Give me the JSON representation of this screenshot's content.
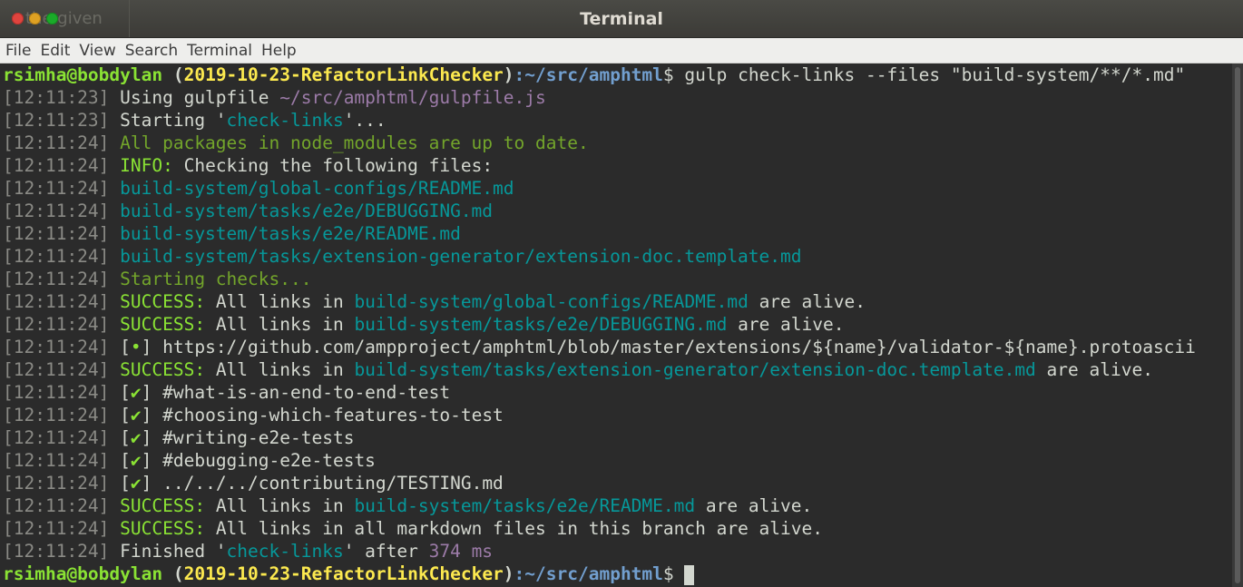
{
  "window": {
    "title": "Terminal",
    "ghost_tab": "the given"
  },
  "menu": [
    "File",
    "Edit",
    "View",
    "Search",
    "Terminal",
    "Help"
  ],
  "prompt": {
    "user_host": "rsimha@bobdylan",
    "branch_open": " (",
    "branch": "2019-10-23-RefactorLinkChecker",
    "branch_close": ")",
    "path": ":~/src/amphtml",
    "dollar": "$ ",
    "command": "gulp check-links --files \"build-system/**/*.md\""
  },
  "lines": [
    [
      {
        "t": "[12:11:23] ",
        "c": "gray"
      },
      {
        "t": "Using gulpfile ",
        "c": "white"
      },
      {
        "t": "~/src/amphtml/gulpfile.js",
        "c": "magenta"
      }
    ],
    [
      {
        "t": "[12:11:23] ",
        "c": "gray"
      },
      {
        "t": "Starting '",
        "c": "white"
      },
      {
        "t": "check-links",
        "c": "cyan"
      },
      {
        "t": "'...",
        "c": "white"
      }
    ],
    [
      {
        "t": "[12:11:24] ",
        "c": "gray"
      },
      {
        "t": "All packages in node_modules are up to date.",
        "c": "green"
      }
    ],
    [
      {
        "t": "[12:11:24] ",
        "c": "gray"
      },
      {
        "t": "INFO: ",
        "c": "yg"
      },
      {
        "t": "Checking the following files:",
        "c": "white"
      }
    ],
    [
      {
        "t": "[12:11:24] ",
        "c": "gray"
      },
      {
        "t": "build-system/global-configs/README.md",
        "c": "cyan"
      }
    ],
    [
      {
        "t": "[12:11:24] ",
        "c": "gray"
      },
      {
        "t": "build-system/tasks/e2e/DEBUGGING.md",
        "c": "cyan"
      }
    ],
    [
      {
        "t": "[12:11:24] ",
        "c": "gray"
      },
      {
        "t": "build-system/tasks/e2e/README.md",
        "c": "cyan"
      }
    ],
    [
      {
        "t": "[12:11:24] ",
        "c": "gray"
      },
      {
        "t": "build-system/tasks/extension-generator/extension-doc.template.md",
        "c": "cyan"
      }
    ],
    [
      {
        "t": "[12:11:24] ",
        "c": "gray"
      },
      {
        "t": "Starting checks...",
        "c": "green"
      }
    ],
    [
      {
        "t": "[12:11:24] ",
        "c": "gray"
      },
      {
        "t": "SUCCESS: ",
        "c": "yg"
      },
      {
        "t": "All links in ",
        "c": "white"
      },
      {
        "t": "build-system/global-configs/README.md",
        "c": "cyan"
      },
      {
        "t": " are alive.",
        "c": "white"
      }
    ],
    [
      {
        "t": "[12:11:24] ",
        "c": "gray"
      },
      {
        "t": "SUCCESS: ",
        "c": "yg"
      },
      {
        "t": "All links in ",
        "c": "white"
      },
      {
        "t": "build-system/tasks/e2e/DEBUGGING.md",
        "c": "cyan"
      },
      {
        "t": " are alive.",
        "c": "white"
      }
    ],
    [
      {
        "t": "[12:11:24] ",
        "c": "gray"
      },
      {
        "t": "[",
        "c": "white"
      },
      {
        "t": "•",
        "c": "yg"
      },
      {
        "t": "] https://github.com/ampproject/amphtml/blob/master/extensions/${name}/validator-${name}.protoascii",
        "c": "white"
      }
    ],
    [
      {
        "t": "[12:11:24] ",
        "c": "gray"
      },
      {
        "t": "SUCCESS: ",
        "c": "yg"
      },
      {
        "t": "All links in ",
        "c": "white"
      },
      {
        "t": "build-system/tasks/extension-generator/extension-doc.template.md",
        "c": "cyan"
      },
      {
        "t": " are alive.",
        "c": "white"
      }
    ],
    [
      {
        "t": "[12:11:24] ",
        "c": "gray"
      },
      {
        "t": "[",
        "c": "white"
      },
      {
        "t": "✔",
        "c": "yg"
      },
      {
        "t": "] #what-is-an-end-to-end-test",
        "c": "white"
      }
    ],
    [
      {
        "t": "[12:11:24] ",
        "c": "gray"
      },
      {
        "t": "[",
        "c": "white"
      },
      {
        "t": "✔",
        "c": "yg"
      },
      {
        "t": "] #choosing-which-features-to-test",
        "c": "white"
      }
    ],
    [
      {
        "t": "[12:11:24] ",
        "c": "gray"
      },
      {
        "t": "[",
        "c": "white"
      },
      {
        "t": "✔",
        "c": "yg"
      },
      {
        "t": "] #writing-e2e-tests",
        "c": "white"
      }
    ],
    [
      {
        "t": "[12:11:24] ",
        "c": "gray"
      },
      {
        "t": "[",
        "c": "white"
      },
      {
        "t": "✔",
        "c": "yg"
      },
      {
        "t": "] #debugging-e2e-tests",
        "c": "white"
      }
    ],
    [
      {
        "t": "[12:11:24] ",
        "c": "gray"
      },
      {
        "t": "[",
        "c": "white"
      },
      {
        "t": "✔",
        "c": "yg"
      },
      {
        "t": "] ../../../contributing/TESTING.md",
        "c": "white"
      }
    ],
    [
      {
        "t": "[12:11:24] ",
        "c": "gray"
      },
      {
        "t": "SUCCESS: ",
        "c": "yg"
      },
      {
        "t": "All links in ",
        "c": "white"
      },
      {
        "t": "build-system/tasks/e2e/README.md",
        "c": "cyan"
      },
      {
        "t": " are alive.",
        "c": "white"
      }
    ],
    [
      {
        "t": "[12:11:24] ",
        "c": "gray"
      },
      {
        "t": "SUCCESS: ",
        "c": "yg"
      },
      {
        "t": "All links in all markdown files in this branch are alive.",
        "c": "white"
      }
    ],
    [
      {
        "t": "[12:11:24] ",
        "c": "gray"
      },
      {
        "t": "Finished '",
        "c": "white"
      },
      {
        "t": "check-links",
        "c": "cyan"
      },
      {
        "t": "' after ",
        "c": "white"
      },
      {
        "t": "374 ms",
        "c": "magenta"
      }
    ]
  ],
  "colors": {
    "background": "#2b2b2b",
    "prompt_user": "#8ae234",
    "prompt_branch": "#fce94f",
    "prompt_path": "#729fcf",
    "link": "#06989a",
    "success": "#8ae234"
  }
}
